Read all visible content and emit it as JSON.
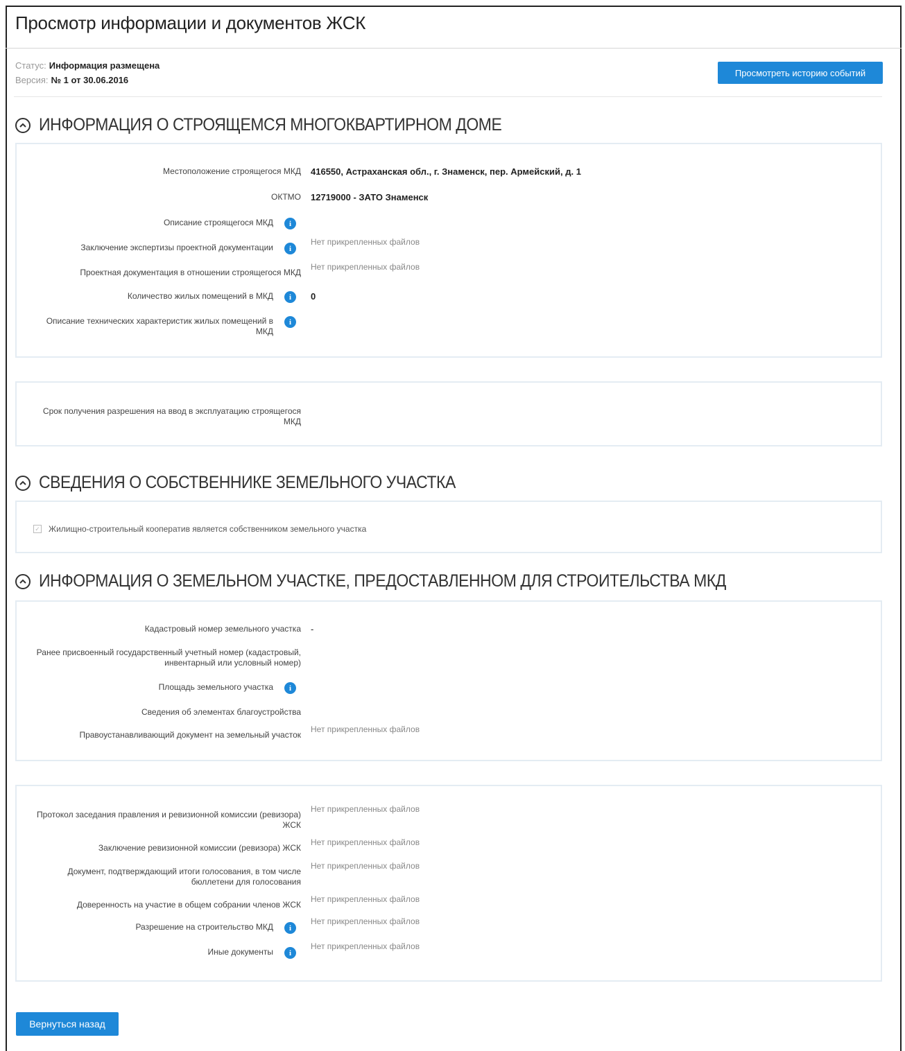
{
  "page": {
    "title": "Просмотр информации и документов ЖСК",
    "status_label": "Статус:",
    "status_value": "Информация размещена",
    "version_label": "Версия:",
    "version_value": "№ 1 от 30.06.2016",
    "history_button": "Просмотреть историю событий",
    "back_button": "Вернуться назад"
  },
  "section1": {
    "title": "ИНФОРМАЦИЯ О СТРОЯЩЕМСЯ МНОГОКВАРТИРНОМ ДОМЕ",
    "fields": [
      {
        "label": "Местоположение строящегося МКД",
        "value": "416550, Астраханская обл., г. Знаменск, пер. Армейский, д. 1"
      },
      {
        "label": "ОКТМО",
        "value": "12719000 - ЗАТО Знаменск"
      },
      {
        "label": "Описание строящегося МКД",
        "value": ""
      },
      {
        "label": "Заключение экспертизы проектной документации",
        "value": "Нет прикрепленных файлов"
      },
      {
        "label": "Проектная документация в отношении строящегося МКД",
        "value": "Нет прикрепленных файлов"
      },
      {
        "label": "Количество жилых помещений в МКД",
        "value": "0"
      },
      {
        "label": "Описание технических характеристик жилых помещений в МКД",
        "value": ""
      }
    ],
    "permit_field": {
      "label": "Срок получения разрешения на ввод в эксплуатацию строящегося МКД",
      "value": ""
    }
  },
  "section2": {
    "title": "СВЕДЕНИЯ О СОБСТВЕННИКЕ ЗЕМЕЛЬНОГО УЧАСТКА",
    "checkbox_label": "Жилищно-строительный кооператив является собственником земельного участка",
    "checkbox_checked": true
  },
  "section3": {
    "title": "ИНФОРМАЦИЯ О ЗЕМЕЛЬНОМ УЧАСТКЕ, ПРЕДОСТАВЛЕННОМ ДЛЯ СТРОИТЕЛЬСТВА МКД",
    "fields": [
      {
        "label": "Кадастровый номер земельного участка",
        "value": "-"
      },
      {
        "label": "Ранее присвоенный государственный учетный номер (кадастровый, инвентарный или условный номер)",
        "value": ""
      },
      {
        "label": "Площадь земельного участка",
        "value": ""
      },
      {
        "label": "Сведения об элементах благоустройства",
        "value": ""
      },
      {
        "label": "Правоустанавливающий документ на земельный участок",
        "value": "Нет прикрепленных файлов"
      }
    ],
    "documents": [
      {
        "label": "Протокол заседания правления и ревизионной комиссии (ревизора) ЖСК",
        "value": "Нет прикрепленных файлов"
      },
      {
        "label": "Заключение ревизионной комиссии (ревизора) ЖСК",
        "value": "Нет прикрепленных файлов"
      },
      {
        "label": "Документ, подтверждающий итоги голосования, в том числе бюллетени для голосования",
        "value": "Нет прикрепленных файлов"
      },
      {
        "label": "Доверенность на участие в общем собрании членов ЖСК",
        "value": "Нет прикрепленных файлов"
      },
      {
        "label": "Разрешение на строительство МКД",
        "value": "Нет прикрепленных файлов"
      },
      {
        "label": "Иные документы",
        "value": "Нет прикрепленных файлов"
      }
    ]
  },
  "icons": {
    "info": "info-icon",
    "collapse": "chevron-up-circle-icon"
  },
  "colors": {
    "accent": "#1e88d8",
    "panel_border": "#e4ecf3"
  }
}
